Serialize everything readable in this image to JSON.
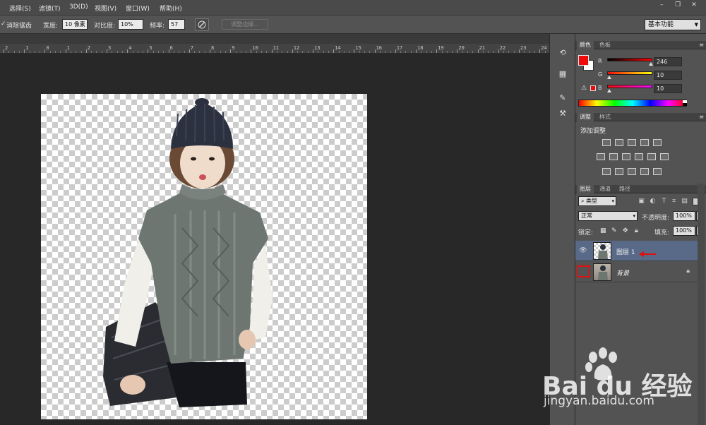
{
  "menubar": {
    "items": [
      "选择(S)",
      "滤镜(T)",
      "3D(D)",
      "视图(V)",
      "窗口(W)",
      "帮助(H)"
    ],
    "window_controls": [
      "–",
      "❐",
      "✕"
    ]
  },
  "options": {
    "anti_alias_label": "消除锯齿",
    "width_label": "宽度:",
    "width_value": "10 像素",
    "contrast_label": "对比度:",
    "contrast_value": "10%",
    "frequency_label": "频率:",
    "frequency_value": "57",
    "refine_edge_label": "调整边缘...",
    "workspace_value": "基本功能"
  },
  "ruler": {
    "labels": [
      "2",
      "1",
      "0",
      "1",
      "2",
      "3",
      "4",
      "5",
      "6",
      "7",
      "8",
      "9",
      "10",
      "11",
      "12",
      "13",
      "14",
      "15",
      "16",
      "17",
      "18",
      "19",
      "20",
      "21",
      "22",
      "23",
      "24"
    ]
  },
  "color_panel": {
    "tabs": [
      "颜色",
      "色板"
    ],
    "fg_color": "#f00a0a",
    "bg_color": "#ffffff",
    "channels": [
      {
        "label": "R",
        "value": "246",
        "level": 0.965
      },
      {
        "label": "G",
        "value": "10",
        "level": 0.04
      },
      {
        "label": "B",
        "value": "10",
        "level": 0.04
      }
    ]
  },
  "adjustments_panel": {
    "tabs": [
      "调整",
      "样式"
    ],
    "title": "添加调整",
    "icons": [
      [
        "brightness-contrast-icon",
        "levels-icon",
        "curves-icon",
        "exposure-icon",
        "vibrance-icon"
      ],
      [
        "hue-saturation-icon",
        "color-balance-icon",
        "black-white-icon",
        "photo-filter-icon",
        "channel-mixer-icon",
        "color-lookup-icon"
      ],
      [
        "invert-icon",
        "posterize-icon",
        "threshold-icon",
        "selective-color-icon",
        "gradient-map-icon"
      ]
    ]
  },
  "layers_panel": {
    "tabs": [
      "图层",
      "通道",
      "路径"
    ],
    "filter_kind": "类型",
    "blend_mode": "正常",
    "opacity_label": "不透明度:",
    "opacity_value": "100%",
    "lock_label": "锁定:",
    "fill_label": "填充:",
    "fill_value": "100%",
    "layers": [
      {
        "name": "图层 1",
        "selected": true
      },
      {
        "name": "背景",
        "selected": false
      }
    ]
  },
  "watermark": {
    "main": "Bai du 经验",
    "sub": "jingyan.baidu.com"
  }
}
